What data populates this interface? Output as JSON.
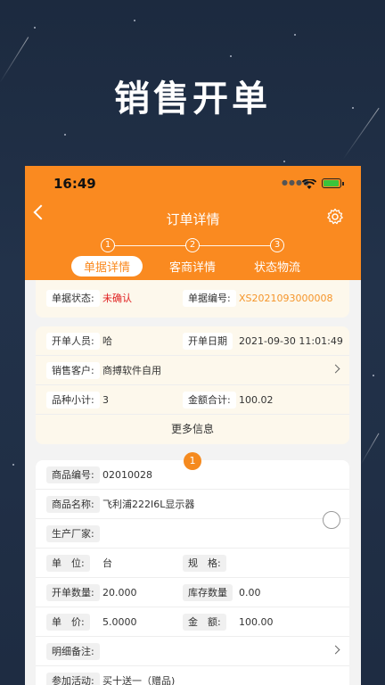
{
  "hero": {
    "title": "销售开单"
  },
  "status_bar": {
    "time": "16:49"
  },
  "nav": {
    "title": "订单详情"
  },
  "steps": [
    {
      "num": "1",
      "label": "单据详情"
    },
    {
      "num": "2",
      "label": "客商详情"
    },
    {
      "num": "3",
      "label": "状态物流"
    }
  ],
  "doc_card": {
    "status_label": "单据状态:",
    "status_value": "未确认",
    "number_label": "单据编号:",
    "number_value": "XS2021093000008"
  },
  "info_card": {
    "creator_label": "开单人员:",
    "creator_value": "哈",
    "date_label": "开单日期",
    "date_value": "2021-09-30 11:01:49",
    "customer_label": "销售客户:",
    "customer_value": "商搏软件自用",
    "variety_label": "品种小计:",
    "variety_value": "3",
    "amount_label": "金额合计:",
    "amount_value": "100.02",
    "more_label": "更多信息"
  },
  "item": {
    "index": "1",
    "code_label": "商品编号:",
    "code_value": "02010028",
    "name_label": "商品名称:",
    "name_value": "飞利浦222I6L显示器",
    "maker_label": "生产厂家:",
    "unit_label": "单　位:",
    "unit_value": "台",
    "spec_label": "规　格:",
    "qty_label": "开单数量:",
    "qty_value": "20.000",
    "stock_label": "库存数量",
    "stock_value": "0.00",
    "price_label": "单　价:",
    "price_value": "5.0000",
    "sum_label": "金　额:",
    "sum_value": "100.00",
    "note_label": "明细备注:",
    "activity_label": "参加活动:",
    "activity_value": "买十送一（赠品)"
  },
  "colors": {
    "accent": "#fa8a20",
    "alert": "#e02020",
    "doc_number": "#f5952a"
  }
}
